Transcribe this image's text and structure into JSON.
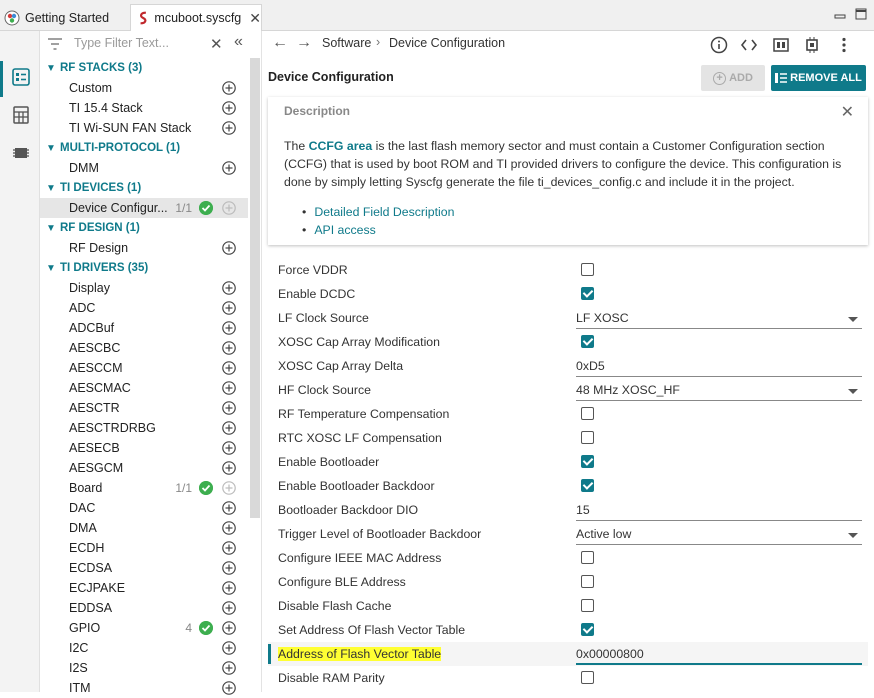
{
  "tabs": [
    {
      "label": "Getting Started",
      "icon": "getting-started-icon"
    },
    {
      "label": "mcuboot.syscfg",
      "icon": "syscfg-file-icon"
    }
  ],
  "filter": {
    "placeholder": "Type Filter Text..."
  },
  "nav": [
    {
      "type": "cat",
      "label": "RF STACKS (3)"
    },
    {
      "type": "item",
      "label": "Custom"
    },
    {
      "type": "item",
      "label": "TI 15.4 Stack"
    },
    {
      "type": "item",
      "label": "TI Wi-SUN FAN Stack"
    },
    {
      "type": "cat",
      "label": "MULTI-PROTOCOL (1)"
    },
    {
      "type": "item",
      "label": "DMM"
    },
    {
      "type": "cat",
      "label": "TI DEVICES (1)"
    },
    {
      "type": "item",
      "label": "Device Configur...",
      "count": "1/1",
      "check": true,
      "selected": true,
      "disabledAdd": true
    },
    {
      "type": "cat",
      "label": "RF DESIGN (1)"
    },
    {
      "type": "item",
      "label": "RF Design"
    },
    {
      "type": "cat",
      "label": "TI DRIVERS (35)"
    },
    {
      "type": "item",
      "label": "Display"
    },
    {
      "type": "item",
      "label": "ADC"
    },
    {
      "type": "item",
      "label": "ADCBuf"
    },
    {
      "type": "item",
      "label": "AESCBC"
    },
    {
      "type": "item",
      "label": "AESCCM"
    },
    {
      "type": "item",
      "label": "AESCMAC"
    },
    {
      "type": "item",
      "label": "AESCTR"
    },
    {
      "type": "item",
      "label": "AESCTRDRBG"
    },
    {
      "type": "item",
      "label": "AESECB"
    },
    {
      "type": "item",
      "label": "AESGCM"
    },
    {
      "type": "item",
      "label": "Board",
      "count": "1/1",
      "check": true,
      "disabledAdd": true
    },
    {
      "type": "item",
      "label": "DAC"
    },
    {
      "type": "item",
      "label": "DMA"
    },
    {
      "type": "item",
      "label": "ECDH"
    },
    {
      "type": "item",
      "label": "ECDSA"
    },
    {
      "type": "item",
      "label": "ECJPAKE"
    },
    {
      "type": "item",
      "label": "EDDSA"
    },
    {
      "type": "item",
      "label": "GPIO",
      "count": "4",
      "check": true
    },
    {
      "type": "item",
      "label": "I2C"
    },
    {
      "type": "item",
      "label": "I2S"
    },
    {
      "type": "item",
      "label": "ITM"
    }
  ],
  "breadcrumb": {
    "root": "Software",
    "sep": "›",
    "current": "Device Configuration"
  },
  "section": {
    "title": "Device Configuration",
    "add_label": "ADD",
    "remove_label": "REMOVE ALL"
  },
  "description": {
    "title": "Description",
    "highlight": "CCFG area",
    "text_before": "The ",
    "text_after": " is the last flash memory sector and must contain a Customer Configuration section (CCFG) that is used by boot ROM and TI provided drivers to configure the device. This configuration is done by simply letting Syscfg generate the file ti_devices_config.c and include it in the project.",
    "links": [
      "Detailed Field Description",
      "API access"
    ]
  },
  "properties": [
    {
      "label": "Force VDDR",
      "kind": "checkbox",
      "checked": false
    },
    {
      "label": "Enable DCDC",
      "kind": "checkbox",
      "checked": true
    },
    {
      "label": "LF Clock Source",
      "kind": "select",
      "value": "LF XOSC"
    },
    {
      "label": "XOSC Cap Array Modification",
      "kind": "checkbox",
      "checked": true
    },
    {
      "label": "XOSC Cap Array Delta",
      "kind": "text",
      "value": "0xD5"
    },
    {
      "label": "HF Clock Source",
      "kind": "select",
      "value": "48 MHz XOSC_HF"
    },
    {
      "label": "RF Temperature Compensation",
      "kind": "checkbox",
      "checked": false
    },
    {
      "label": "RTC XOSC LF Compensation",
      "kind": "checkbox",
      "checked": false
    },
    {
      "label": "Enable Bootloader",
      "kind": "checkbox",
      "checked": true
    },
    {
      "label": "Enable Bootloader Backdoor",
      "kind": "checkbox",
      "checked": true
    },
    {
      "label": "Bootloader Backdoor DIO",
      "kind": "text",
      "value": "15"
    },
    {
      "label": "Trigger Level of Bootloader Backdoor",
      "kind": "select",
      "value": "Active low"
    },
    {
      "label": "Configure IEEE MAC Address",
      "kind": "checkbox",
      "checked": false
    },
    {
      "label": "Configure BLE Address",
      "kind": "checkbox",
      "checked": false
    },
    {
      "label": "Disable Flash Cache",
      "kind": "checkbox",
      "checked": false
    },
    {
      "label": "Set Address Of Flash Vector Table",
      "kind": "checkbox",
      "checked": true
    },
    {
      "label": "Address of Flash Vector Table",
      "kind": "text",
      "value": "0x00000800",
      "highlight": true,
      "focused": true
    },
    {
      "label": "Disable RAM Parity",
      "kind": "checkbox",
      "checked": false
    }
  ],
  "colors": {
    "accent": "#0f7a8a",
    "check": "#3dae4f",
    "highlight": "#ffff33"
  }
}
